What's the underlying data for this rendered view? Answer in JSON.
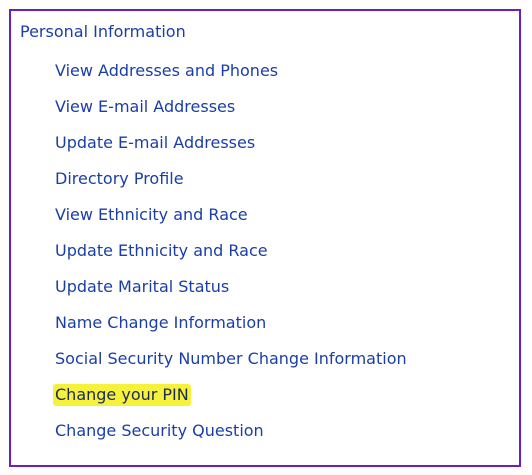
{
  "menu": {
    "heading": "Personal Information",
    "items": [
      {
        "label": "View Addresses and Phones",
        "highlighted": false
      },
      {
        "label": "View E-mail Addresses",
        "highlighted": false
      },
      {
        "label": "Update E-mail Addresses",
        "highlighted": false
      },
      {
        "label": "Directory Profile",
        "highlighted": false
      },
      {
        "label": "View Ethnicity and Race",
        "highlighted": false
      },
      {
        "label": "Update Ethnicity and Race",
        "highlighted": false
      },
      {
        "label": "Update Marital Status",
        "highlighted": false
      },
      {
        "label": "Name Change Information",
        "highlighted": false
      },
      {
        "label": "Social Security Number Change Information",
        "highlighted": false
      },
      {
        "label": "Change your PIN",
        "highlighted": true
      },
      {
        "label": "Change Security Question",
        "highlighted": false
      }
    ]
  },
  "colors": {
    "border": "#6a1fbf",
    "link": "#1a3ea8",
    "highlight": "#f6f23c"
  }
}
